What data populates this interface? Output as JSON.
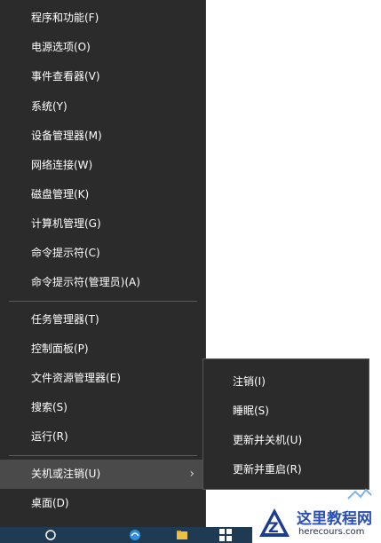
{
  "menu": {
    "group1": [
      {
        "label": "程序和功能(F)"
      },
      {
        "label": "电源选项(O)"
      },
      {
        "label": "事件查看器(V)"
      },
      {
        "label": "系统(Y)"
      },
      {
        "label": "设备管理器(M)"
      },
      {
        "label": "网络连接(W)"
      },
      {
        "label": "磁盘管理(K)"
      },
      {
        "label": "计算机管理(G)"
      },
      {
        "label": "命令提示符(C)"
      },
      {
        "label": "命令提示符(管理员)(A)"
      }
    ],
    "group2": [
      {
        "label": "任务管理器(T)"
      },
      {
        "label": "控制面板(P)"
      },
      {
        "label": "文件资源管理器(E)"
      },
      {
        "label": "搜索(S)"
      },
      {
        "label": "运行(R)"
      }
    ],
    "shutdown": {
      "label": "关机或注销(U)",
      "chevron": "›"
    },
    "desktop": {
      "label": "桌面(D)"
    }
  },
  "submenu": {
    "items": [
      {
        "label": "注销(I)"
      },
      {
        "label": "睡眠(S)"
      },
      {
        "label": "更新并关机(U)"
      },
      {
        "label": "更新并重启(R)"
      }
    ]
  },
  "taskbar": {
    "icons": [
      "search-circle-icon",
      "edge-icon",
      "file-explorer-icon",
      "store-icon",
      "windows-icon"
    ]
  },
  "watermark": {
    "title": "这里教程网",
    "url": "herecours.com"
  },
  "colors": {
    "menu_bg": "#2b2b2b",
    "highlight": "#4a4a4a",
    "text": "#ffffff",
    "taskbar": "#1f3a53"
  }
}
